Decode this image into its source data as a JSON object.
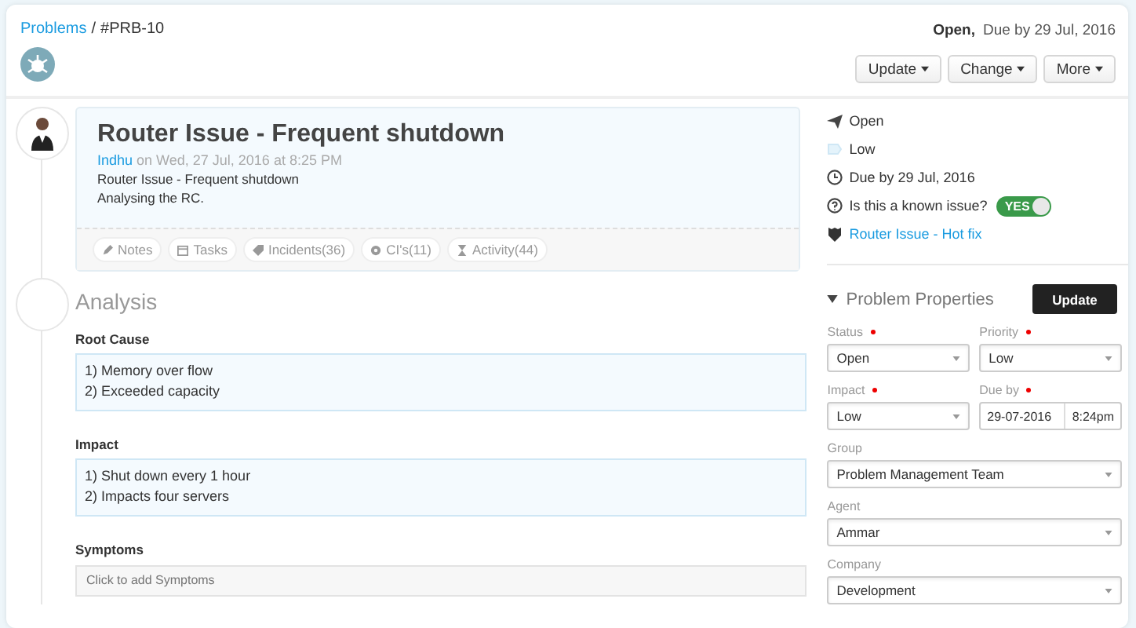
{
  "breadcrumb": {
    "parent": "Problems",
    "separator": "/",
    "current": "#PRB-10"
  },
  "header_status": {
    "status": "Open,",
    "due": "Due by 29 Jul, 2016"
  },
  "action_buttons": [
    "Update",
    "Change",
    "More"
  ],
  "problem": {
    "title": "Router Issue - Frequent shutdown",
    "author": "Indhu",
    "timestamp": "on Wed, 27 Jul, 2016 at 8:25 PM",
    "description": [
      "Router Issue - Frequent shutdown",
      "Analysing the RC."
    ],
    "tabs": [
      {
        "kind": "notes",
        "label": "Notes"
      },
      {
        "kind": "tasks",
        "label": "Tasks"
      },
      {
        "kind": "incidents",
        "label": "Incidents(36)"
      },
      {
        "kind": "cis",
        "label": "CI's(11)"
      },
      {
        "kind": "activity",
        "label": "Activity(44)"
      }
    ]
  },
  "analysis": {
    "heading": "Analysis",
    "sections": [
      {
        "label": "Root Cause",
        "lines": [
          "1) Memory over flow",
          "2) Exceeded capacity"
        ]
      },
      {
        "label": "Impact",
        "lines": [
          "1) Shut down every 1 hour",
          "2) Impacts four servers"
        ]
      },
      {
        "label": "Symptoms",
        "placeholder": "Click to add Symptoms"
      }
    ]
  },
  "summary": [
    {
      "kind": "status",
      "text": "Open"
    },
    {
      "kind": "priority",
      "text": "Low"
    },
    {
      "kind": "due",
      "text": "Due by 29 Jul, 2016"
    },
    {
      "kind": "known_issue",
      "text": "Is this a known issue?",
      "toggle": {
        "on": true,
        "label": "YES"
      }
    },
    {
      "kind": "solution",
      "text": "Router Issue - Hot fix"
    }
  ],
  "properties": {
    "title": "Problem Properties",
    "expanded": true,
    "button": "Update",
    "fields": [
      {
        "kind": "select",
        "label": "Status",
        "required": true,
        "value": "Open",
        "half": true
      },
      {
        "kind": "select",
        "label": "Priority",
        "required": true,
        "value": "Low",
        "half": true
      },
      {
        "kind": "select",
        "label": "Impact",
        "required": true,
        "value": "Low",
        "half": true
      },
      {
        "kind": "datetime",
        "label": "Due by",
        "required": true,
        "date": "29-07-2016",
        "time": "8:24pm",
        "half": true
      },
      {
        "kind": "select",
        "label": "Group",
        "required": false,
        "value": "Problem Management Team",
        "half": false
      },
      {
        "kind": "select",
        "label": "Agent",
        "required": false,
        "value": "Ammar",
        "half": false
      },
      {
        "kind": "select",
        "label": "Company",
        "required": false,
        "value": "Development",
        "half": false
      }
    ]
  }
}
